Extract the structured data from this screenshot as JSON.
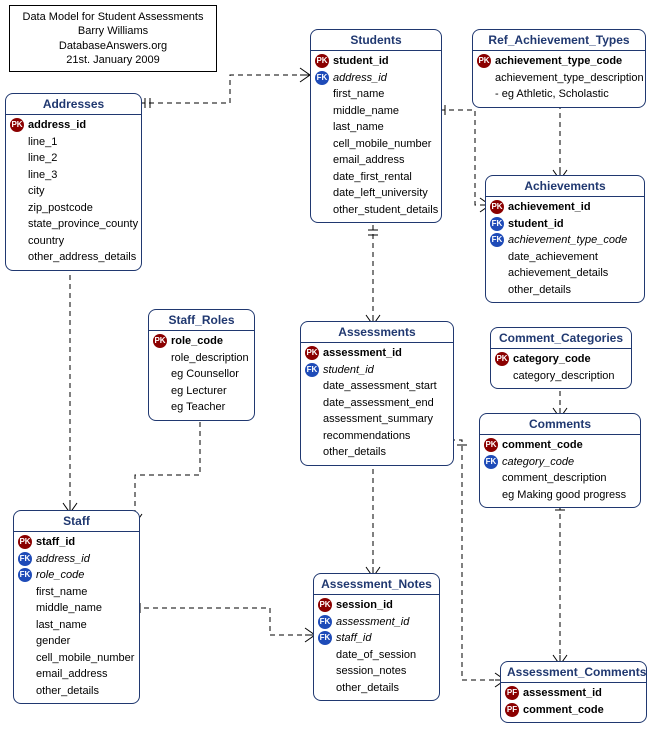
{
  "info": {
    "title": "Data Model for Student Assessments",
    "author": "Barry Williams",
    "site": "DatabaseAnswers.org",
    "date": "21st. January 2009"
  },
  "entities": {
    "addresses": {
      "title": "Addresses",
      "attrs": [
        {
          "key": "PK",
          "name": "address_id",
          "bold": true
        },
        {
          "key": "",
          "name": "line_1"
        },
        {
          "key": "",
          "name": "line_2"
        },
        {
          "key": "",
          "name": "line_3"
        },
        {
          "key": "",
          "name": "city"
        },
        {
          "key": "",
          "name": "zip_postcode"
        },
        {
          "key": "",
          "name": "state_province_county"
        },
        {
          "key": "",
          "name": "country"
        },
        {
          "key": "",
          "name": "other_address_details"
        }
      ]
    },
    "students": {
      "title": "Students",
      "attrs": [
        {
          "key": "PK",
          "name": "student_id",
          "bold": true
        },
        {
          "key": "FK",
          "name": "address_id",
          "italic": true
        },
        {
          "key": "",
          "name": "first_name"
        },
        {
          "key": "",
          "name": "middle_name"
        },
        {
          "key": "",
          "name": "last_name"
        },
        {
          "key": "",
          "name": "cell_mobile_number"
        },
        {
          "key": "",
          "name": "email_address"
        },
        {
          "key": "",
          "name": "date_first_rental"
        },
        {
          "key": "",
          "name": "date_left_university"
        },
        {
          "key": "",
          "name": "other_student_details"
        }
      ]
    },
    "ref_ach_types": {
      "title": "Ref_Achievement_Types",
      "attrs": [
        {
          "key": "PK",
          "name": "achievement_type_code",
          "bold": true
        },
        {
          "key": "",
          "name": "achievement_type_description"
        },
        {
          "key": "",
          "name": "- eg Athletic, Scholastic"
        }
      ]
    },
    "achievements": {
      "title": "Achievements",
      "attrs": [
        {
          "key": "PK",
          "name": "achievement_id",
          "bold": true
        },
        {
          "key": "FK",
          "name": "student_id",
          "bold": true
        },
        {
          "key": "FK",
          "name": "achievement_type_code",
          "italic": true
        },
        {
          "key": "",
          "name": "date_achievement"
        },
        {
          "key": "",
          "name": "achievement_details"
        },
        {
          "key": "",
          "name": "other_details"
        }
      ]
    },
    "staff_roles": {
      "title": "Staff_Roles",
      "attrs": [
        {
          "key": "PK",
          "name": "role_code",
          "bold": true
        },
        {
          "key": "",
          "name": "role_description"
        },
        {
          "key": "",
          "name": "eg Counsellor"
        },
        {
          "key": "",
          "name": "eg Lecturer"
        },
        {
          "key": "",
          "name": "eg Teacher"
        }
      ]
    },
    "assessments": {
      "title": "Assessments",
      "attrs": [
        {
          "key": "PK",
          "name": "assessment_id",
          "bold": true
        },
        {
          "key": "FK",
          "name": "student_id",
          "italic": true
        },
        {
          "key": "",
          "name": "date_assessment_start"
        },
        {
          "key": "",
          "name": "date_assessment_end"
        },
        {
          "key": "",
          "name": "assessment_summary"
        },
        {
          "key": "",
          "name": "recommendations"
        },
        {
          "key": "",
          "name": "other_details"
        }
      ]
    },
    "comment_categories": {
      "title": "Comment_Categories",
      "attrs": [
        {
          "key": "PK",
          "name": "category_code",
          "bold": true
        },
        {
          "key": "",
          "name": "category_description"
        }
      ]
    },
    "comments": {
      "title": "Comments",
      "attrs": [
        {
          "key": "PK",
          "name": "comment_code",
          "bold": true
        },
        {
          "key": "FK",
          "name": "category_code",
          "italic": true
        },
        {
          "key": "",
          "name": "comment_description"
        },
        {
          "key": "",
          "name": "eg Making good progress"
        }
      ]
    },
    "staff": {
      "title": "Staff",
      "attrs": [
        {
          "key": "PK",
          "name": "staff_id",
          "bold": true
        },
        {
          "key": "FK",
          "name": "address_id",
          "italic": true
        },
        {
          "key": "FK",
          "name": "role_code",
          "italic": true
        },
        {
          "key": "",
          "name": "first_name"
        },
        {
          "key": "",
          "name": "middle_name"
        },
        {
          "key": "",
          "name": "last_name"
        },
        {
          "key": "",
          "name": "gender"
        },
        {
          "key": "",
          "name": "cell_mobile_number"
        },
        {
          "key": "",
          "name": "email_address"
        },
        {
          "key": "",
          "name": "other_details"
        }
      ]
    },
    "assessment_notes": {
      "title": "Assessment_Notes",
      "attrs": [
        {
          "key": "PK",
          "name": "session_id",
          "bold": true
        },
        {
          "key": "FK",
          "name": "assessment_id",
          "italic": true
        },
        {
          "key": "FK",
          "name": "staff_id",
          "italic": true
        },
        {
          "key": "",
          "name": "date_of_session"
        },
        {
          "key": "",
          "name": "session_notes"
        },
        {
          "key": "",
          "name": "other_details"
        }
      ]
    },
    "assessment_comments": {
      "title": "Assessment_Comments",
      "attrs": [
        {
          "key": "PF",
          "name": "assessment_id",
          "bold": true
        },
        {
          "key": "PF",
          "name": "comment_code",
          "bold": true
        }
      ]
    }
  },
  "relationships": [
    {
      "from": "addresses",
      "to": "students",
      "type": "one-to-many"
    },
    {
      "from": "addresses",
      "to": "staff",
      "type": "one-to-many"
    },
    {
      "from": "students",
      "to": "achievements",
      "type": "one-to-many"
    },
    {
      "from": "ref_ach_types",
      "to": "achievements",
      "type": "one-to-many"
    },
    {
      "from": "students",
      "to": "assessments",
      "type": "one-to-many"
    },
    {
      "from": "staff_roles",
      "to": "staff",
      "type": "one-to-many"
    },
    {
      "from": "staff",
      "to": "assessment_notes",
      "type": "one-to-many"
    },
    {
      "from": "assessments",
      "to": "assessment_notes",
      "type": "one-to-many"
    },
    {
      "from": "assessments",
      "to": "assessment_comments",
      "type": "one-to-many"
    },
    {
      "from": "comment_categories",
      "to": "comments",
      "type": "one-to-many"
    },
    {
      "from": "comments",
      "to": "assessment_comments",
      "type": "one-to-many"
    }
  ]
}
